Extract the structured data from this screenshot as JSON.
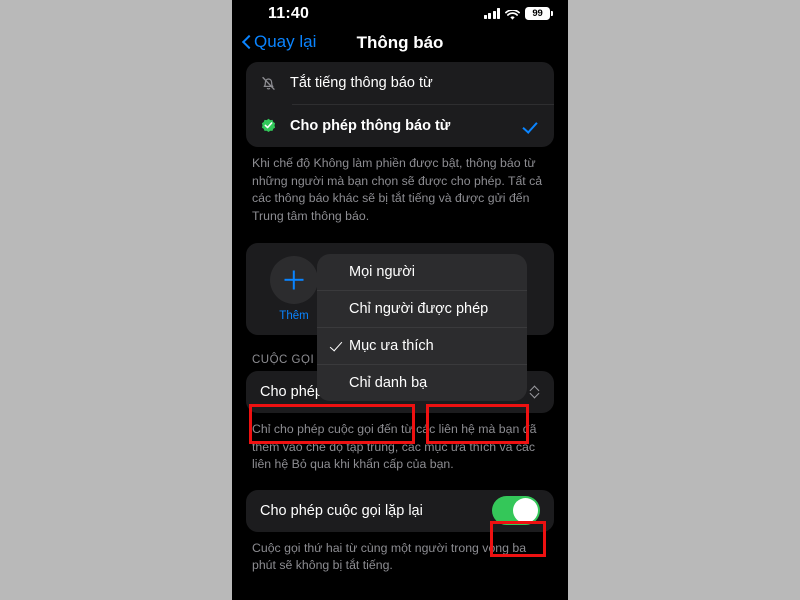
{
  "status_bar": {
    "time": "11:40",
    "battery_level": "99",
    "signal_icon": "cellular-signal-icon",
    "wifi_icon": "wifi-icon",
    "battery_icon": "battery-icon"
  },
  "nav": {
    "back_label": "Quay lại",
    "title": "Thông báo"
  },
  "notification_card": {
    "rows": [
      {
        "label": "Tắt tiếng thông báo từ",
        "icon": "bell-slash-icon",
        "selected": false
      },
      {
        "label": "Cho phép thông báo từ",
        "icon": "green-check-badge-icon",
        "selected": true
      }
    ],
    "footnote": "Khi chế độ Không làm phiền được bật, thông báo từ những người mà bạn chọn sẽ được cho phép. Tất cả các thông báo khác sẽ bị tắt tiếng và được gửi đến Trung tâm thông báo."
  },
  "people_card": {
    "add_label": "Thêm",
    "add_icon": "plus-icon"
  },
  "calls_section": {
    "header": "CUỘC GỌI",
    "allow_calls_label": "Cho phép cuộc gọi từ",
    "allow_calls_value": "Mục ưa thích",
    "stepper_icon": "up-down-chevron-icon",
    "footnote": "Chỉ cho phép cuộc gọi đến từ các liên hệ mà bạn đã thêm vào chế độ tập trung, các mục ưa thích và các liên hệ Bỏ qua khi khẩn cấp của bạn.",
    "repeat_calls_label": "Cho phép cuộc gọi lặp lại",
    "repeat_calls_on": true,
    "repeat_footnote": "Cuộc gọi thứ hai từ cùng một người trong vòng ba phút sẽ không bị tắt tiếng."
  },
  "dropdown": {
    "options": [
      {
        "label": "Mọi người",
        "checked": false
      },
      {
        "label": "Chỉ người được phép",
        "checked": false
      },
      {
        "label": "Mục ưa thích",
        "checked": true
      },
      {
        "label": "Chỉ danh bạ",
        "checked": false
      }
    ]
  },
  "colors": {
    "accent_blue": "#0a84ff",
    "toggle_green": "#34c759",
    "annotation_red": "#ee1111",
    "card_bg": "#1c1c1e",
    "menu_bg": "#2c2c2e",
    "page_bg": "#b9b9b9"
  }
}
